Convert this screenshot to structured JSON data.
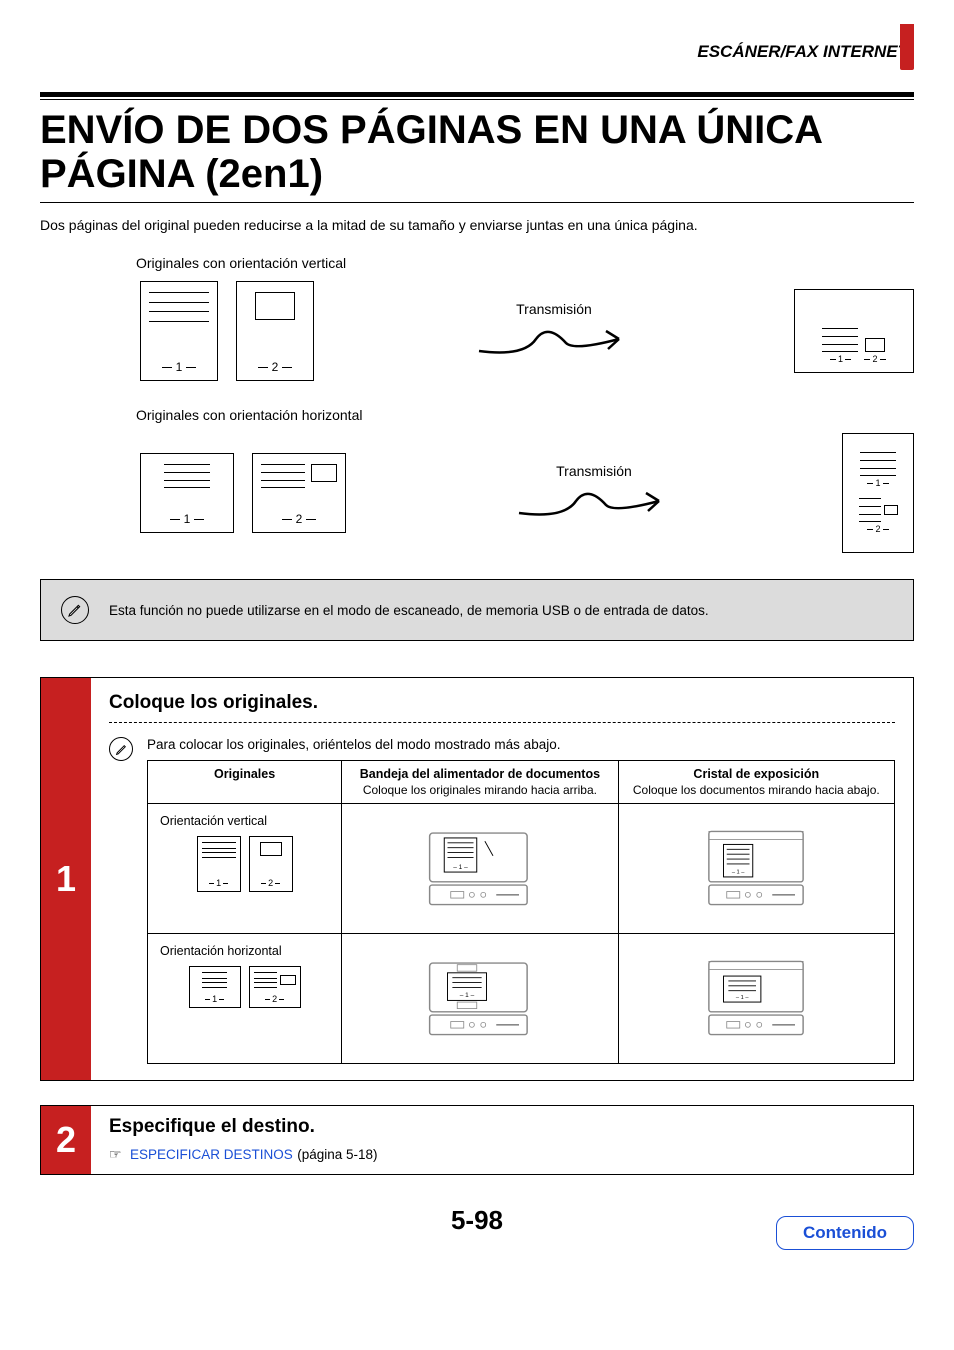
{
  "header": "ESCÁNER/FAX INTERNET",
  "title": "ENVÍO DE DOS PÁGINAS EN UNA ÚNICA PÁGINA (2en1)",
  "intro": "Dos páginas del original pueden reducirse a la mitad de su tamaño y enviarse juntas en una única página.",
  "portrait_label": "Originales con orientación vertical",
  "landscape_label": "Originales con orientación horizontal",
  "transmission": "Transmisión",
  "page1": "1",
  "page2": "2",
  "note": "Esta función no puede utilizarse en el modo de escaneado, de memoria USB o de entrada de datos.",
  "step1": {
    "num": "1",
    "title": "Coloque los originales.",
    "sub": "Para colocar los originales, oriéntelos del modo mostrado más abajo.",
    "col_originals": "Originales",
    "col_feeder": "Bandeja del alimentador de documentos",
    "col_feeder_sub": "Coloque los originales mirando hacia arriba.",
    "col_glass": "Cristal de exposición",
    "col_glass_sub": "Coloque los documentos mirando hacia abajo.",
    "row_port": "Orientación vertical",
    "row_land": "Orientación horizontal"
  },
  "step2": {
    "num": "2",
    "title": "Especifique el destino.",
    "link": "ESPECIFICAR DESTINOS",
    "ref": " (página 5-18)"
  },
  "page_number": "5-98",
  "contents": "Contenido"
}
